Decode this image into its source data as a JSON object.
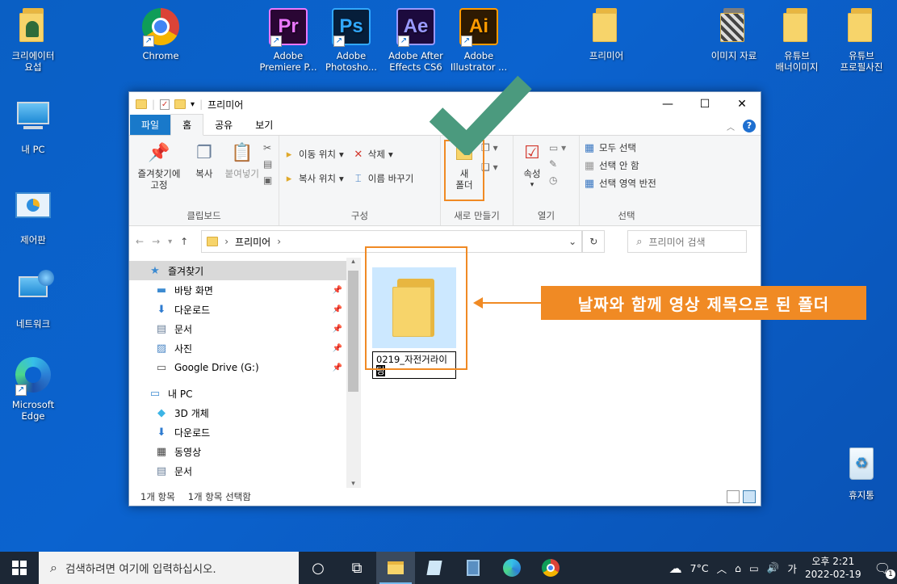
{
  "desktop_icons": [
    {
      "name": "creator-user-folder-icon",
      "label": "크리에이터\n요섭"
    },
    {
      "name": "chrome-icon",
      "label": "Chrome"
    },
    {
      "name": "premiere-icon",
      "label": "Adobe\nPremiere P...",
      "abbr": "Pr"
    },
    {
      "name": "photoshop-icon",
      "label": "Adobe\nPhotosho...",
      "abbr": "Ps"
    },
    {
      "name": "after-effects-icon",
      "label": "Adobe After\nEffects CS6",
      "abbr": "Ae"
    },
    {
      "name": "illustrator-icon",
      "label": "Adobe\nIllustrator ...",
      "abbr": "Ai"
    },
    {
      "name": "premiere-folder-icon",
      "label": "프리미어"
    },
    {
      "name": "image-material-folder-icon",
      "label": "이미지 자료"
    },
    {
      "name": "youtube-banner-folder-icon",
      "label": "유튜브\n배너이미지"
    },
    {
      "name": "youtube-profile-folder-icon",
      "label": "유튜브\n프로필사진"
    },
    {
      "name": "my-pc-icon",
      "label": "내 PC"
    },
    {
      "name": "control-panel-icon",
      "label": "제어판"
    },
    {
      "name": "network-icon",
      "label": "네트워크"
    },
    {
      "name": "edge-icon",
      "label": "Microsoft\nEdge"
    },
    {
      "name": "recycle-bin-icon",
      "label": "휴지통"
    }
  ],
  "window": {
    "title": "프리미어",
    "tabs": [
      "파일",
      "홈",
      "공유",
      "보기"
    ],
    "active_tab": "홈",
    "clipboard": {
      "pin": "즐겨찾기에\n고정",
      "copy": "복사",
      "paste": "붙여넣기",
      "group": "클립보드"
    },
    "organize": {
      "move_to": "이동 위치",
      "copy_to": "복사 위치",
      "delete": "삭제",
      "rename": "이름 바꾸기",
      "group": "구성"
    },
    "new": {
      "new_folder": "새\n폴더",
      "group": "새로 만들기"
    },
    "open": {
      "properties": "속성",
      "group": "열기"
    },
    "select": {
      "select_all": "모두 선택",
      "select_none": "선택 안 함",
      "invert": "선택 영역 반전",
      "group": "선택"
    },
    "address": {
      "path": "프리미어",
      "search_placeholder": "프리미어 검색"
    },
    "nav": [
      {
        "label": "즐겨찾기",
        "icon": "star-icon",
        "level": 0,
        "selected": true
      },
      {
        "label": "바탕 화면",
        "icon": "desktop-icon",
        "level": 1,
        "pinned": true
      },
      {
        "label": "다운로드",
        "icon": "download-icon",
        "level": 1,
        "pinned": true
      },
      {
        "label": "문서",
        "icon": "document-icon",
        "level": 1,
        "pinned": true
      },
      {
        "label": "사진",
        "icon": "picture-icon",
        "level": 1,
        "pinned": true
      },
      {
        "label": "Google Drive (G:)",
        "icon": "drive-icon",
        "level": 1,
        "pinned": true
      },
      {
        "label": "내 PC",
        "icon": "pc-icon",
        "level": 0
      },
      {
        "label": "3D 개체",
        "icon": "cube-icon",
        "level": 1
      },
      {
        "label": "다운로드",
        "icon": "download-icon",
        "level": 1
      },
      {
        "label": "동영상",
        "icon": "video-icon",
        "level": 1
      },
      {
        "label": "문서",
        "icon": "document-icon",
        "level": 1
      }
    ],
    "folder_name_editing": "0219_자전거라이",
    "folder_name_selected_char": "딩",
    "status": {
      "items": "1개 항목",
      "selected": "1개 항목 선택함"
    }
  },
  "callout": "날짜와 함께 영상 제목으로 된 폴더",
  "colors": {
    "accent_orange": "#f08a24",
    "checkmark_green": "#4b9a7e",
    "file_tab": "#1979ca",
    "desktop_blue": "#0b63cf"
  },
  "taskbar": {
    "search_placeholder": "검색하려면 여기에 입력하십시오.",
    "weather": "7°C",
    "ime": "가",
    "time": "오후 2:21",
    "date": "2022-02-19",
    "notification_count": "1"
  }
}
